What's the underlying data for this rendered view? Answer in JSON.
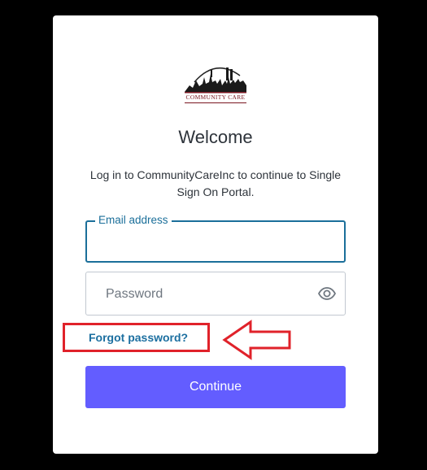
{
  "logo": {
    "text": "COMMUNITY CARE",
    "icon": "community-care-logo"
  },
  "header": {
    "title": "Welcome",
    "subtitle": "Log in to CommunityCareInc to continue to Single Sign On Portal."
  },
  "email": {
    "label": "Email address",
    "value": ""
  },
  "password": {
    "placeholder": "Password",
    "value": "",
    "toggle_icon": "eye-icon"
  },
  "links": {
    "forgot_password": "Forgot password?"
  },
  "annotation": {
    "highlight_color": "#e0222a",
    "arrow_icon": "left-arrow-outline-icon"
  },
  "actions": {
    "continue_label": "Continue"
  },
  "colors": {
    "accent": "#635dff",
    "link": "#1c6fa0",
    "focus": "#1b6f9a",
    "logo": "#7a1620"
  }
}
